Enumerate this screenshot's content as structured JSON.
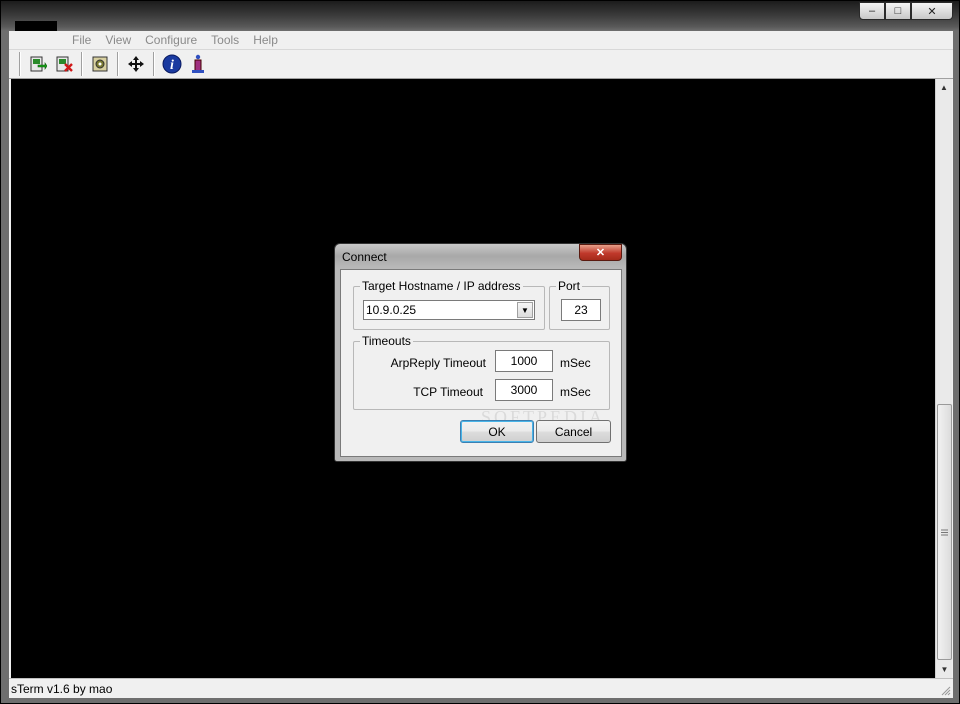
{
  "window": {
    "caption_buttons": {
      "minimize": "–",
      "maximize": "□",
      "close": "✕"
    }
  },
  "menubar": {
    "items": [
      "File",
      "View",
      "Configure",
      "Tools",
      "Help"
    ]
  },
  "toolbar": {
    "buttons": [
      {
        "icon": "connect-icon"
      },
      {
        "icon": "disconnect-icon"
      },
      {
        "icon": "settings-icon"
      },
      {
        "icon": "move-icon"
      },
      {
        "icon": "info-icon"
      },
      {
        "icon": "about-icon"
      }
    ]
  },
  "statusbar": {
    "text": "sTerm v1.6 by mao"
  },
  "dialog": {
    "title": "Connect",
    "close_label": "✕",
    "target": {
      "legend": "Target Hostname / IP address",
      "value": "10.9.0.25"
    },
    "port": {
      "legend": "Port",
      "value": "23"
    },
    "timeouts": {
      "legend": "Timeouts",
      "arpreply_label": "ArpReply Timeout",
      "arpreply_value": "1000",
      "arpreply_unit": "mSec",
      "tcp_label": "TCP Timeout",
      "tcp_value": "3000",
      "tcp_unit": "mSec"
    },
    "ok_label": "OK",
    "cancel_label": "Cancel",
    "watermark": "SOFTPEDIA"
  },
  "colors": {
    "terminal_bg": "#000000",
    "client_bg": "#f0f0f0",
    "menu_text": "#8a8a8a",
    "default_button_border": "#3c7fb1"
  }
}
